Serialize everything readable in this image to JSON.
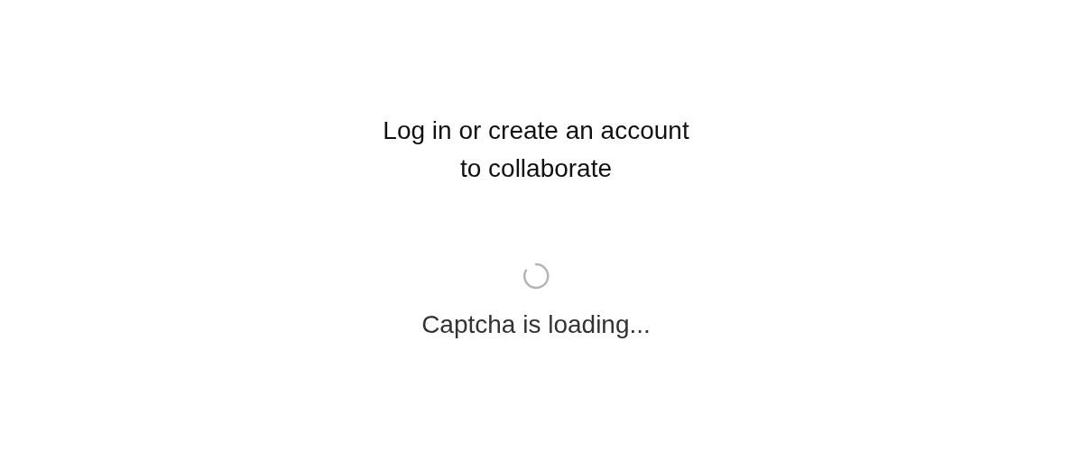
{
  "heading": "Log in or create an account to collaborate",
  "captcha": {
    "status": "Captcha is loading..."
  }
}
